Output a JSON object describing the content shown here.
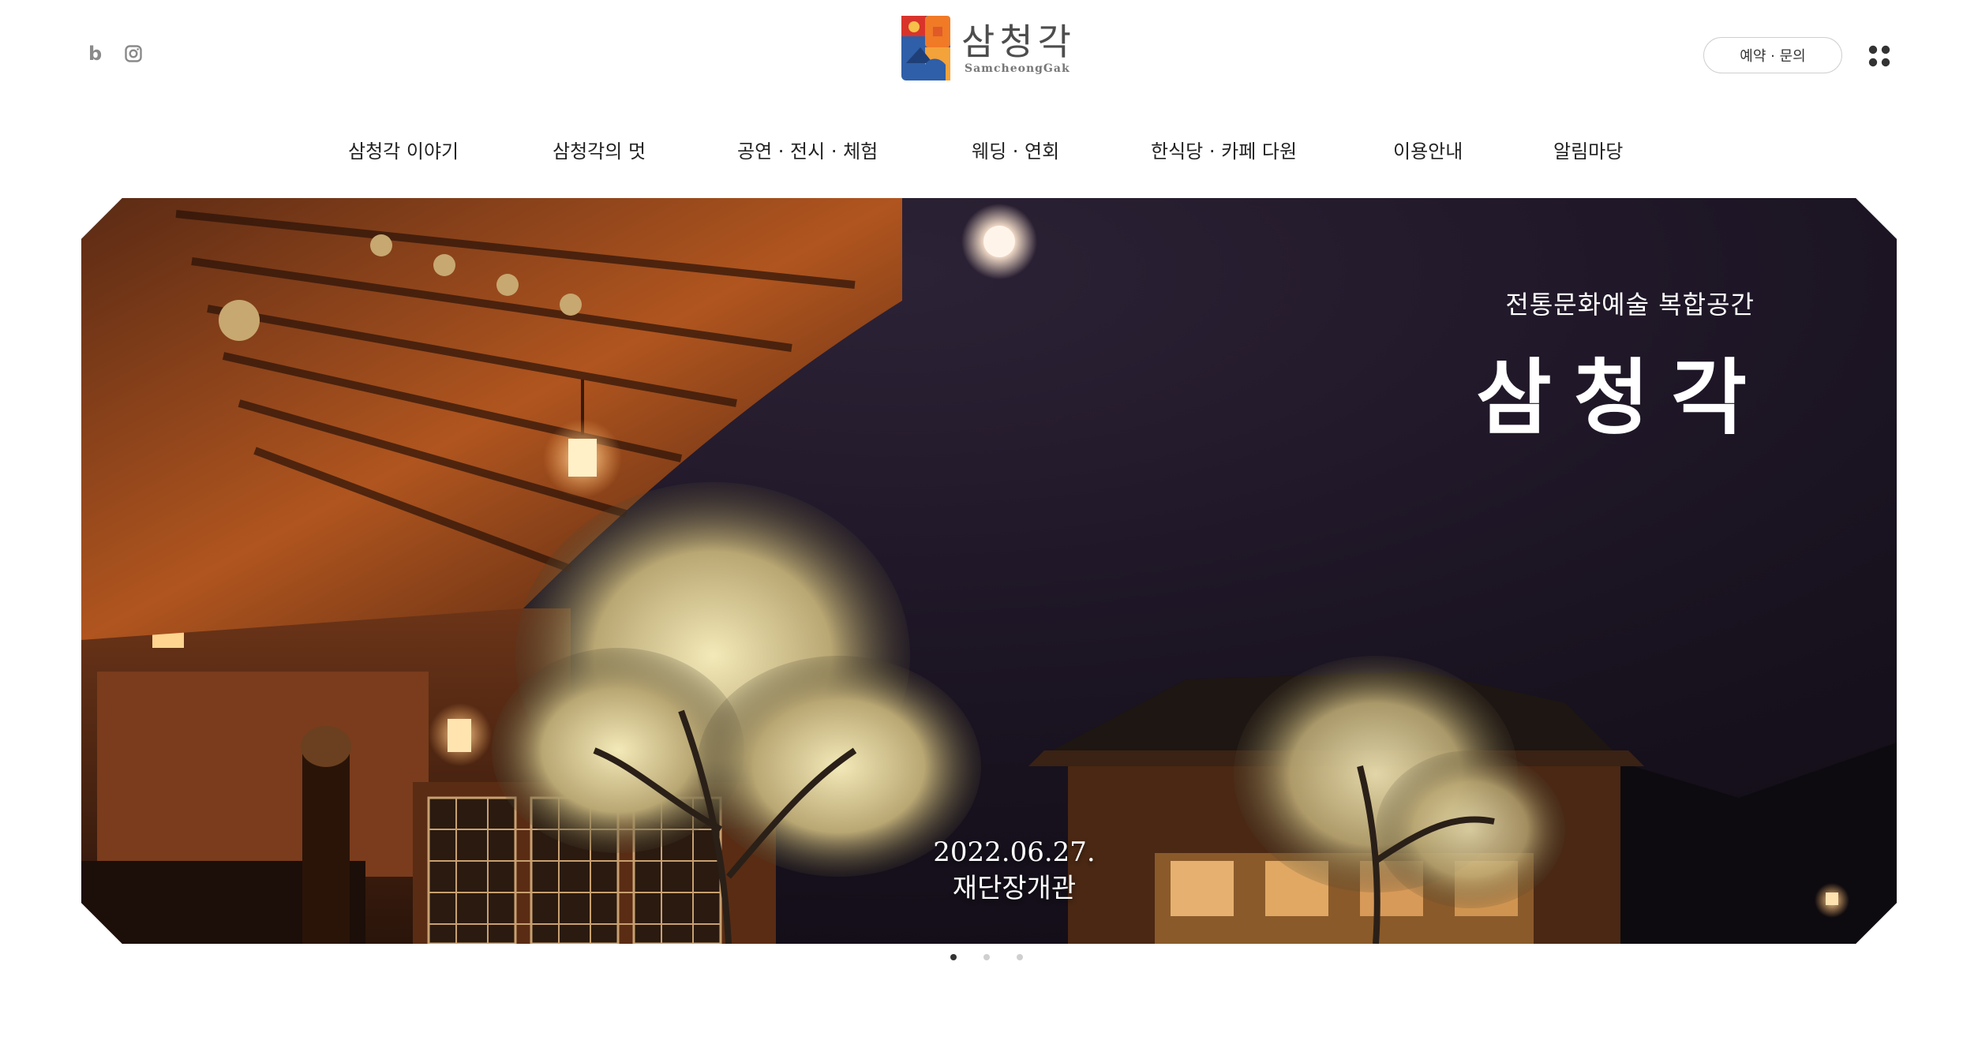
{
  "header": {
    "social": {
      "blog_letter": "b",
      "blog_icon": "blog-icon",
      "instagram_icon": "instagram-icon"
    },
    "logo": {
      "korean": "삼청각",
      "english": "SamcheongGak"
    },
    "reserve_label": "예약 · 문의",
    "menu_icon": "grid-menu-icon"
  },
  "nav": {
    "items": [
      "삼청각 이야기",
      "삼청각의 멋",
      "공연 · 전시 · 체험",
      "웨딩 · 연회",
      "한식당 · 카페 다원",
      "이용안내",
      "알림마당"
    ]
  },
  "hero": {
    "subtitle": "전통문화예술 복합공간",
    "title": "삼청각",
    "date": "2022.06.27.",
    "caption": "재단장개관"
  },
  "pager": {
    "count": 3,
    "active_index": 0
  },
  "colors": {
    "logo_blue": "#2e5fa8",
    "logo_orange": "#f07a26",
    "logo_red": "#d9342b",
    "night_sky": "#1b1422",
    "pager_active": "#333333",
    "pager_inactive": "#cfcfcf"
  }
}
